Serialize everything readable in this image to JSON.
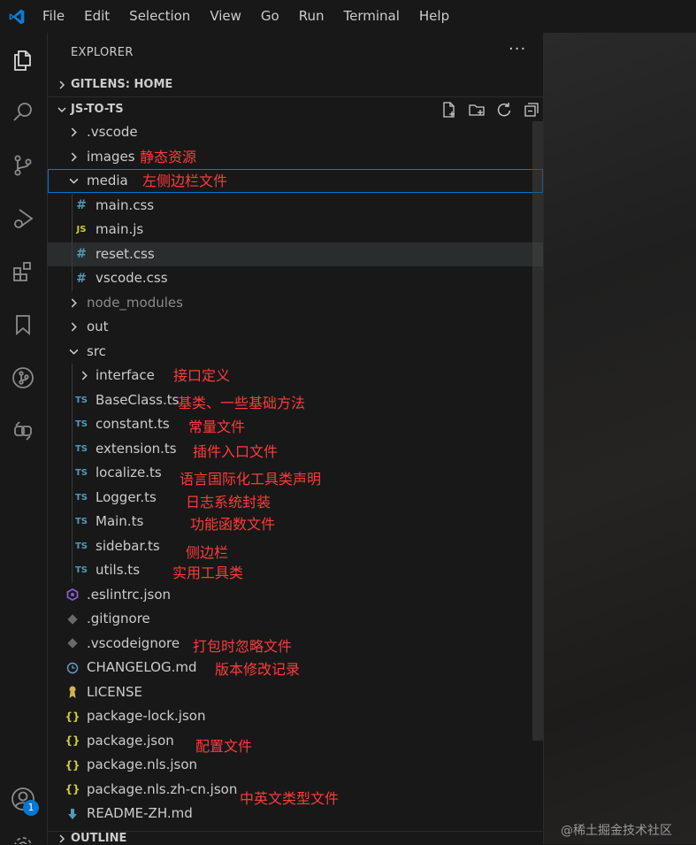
{
  "menu": [
    "File",
    "Edit",
    "Selection",
    "View",
    "Go",
    "Run",
    "Terminal",
    "Help"
  ],
  "activity": {
    "icons": [
      "explorer-icon",
      "search-icon",
      "source-control-icon",
      "run-debug-icon",
      "extensions-icon",
      "bookmarks-icon",
      "gitlens-icon",
      "remote-explorer-icon",
      "accounts-icon",
      "manage-gear-icon"
    ],
    "accounts_badge": "1"
  },
  "sidebar": {
    "title": "EXPLORER",
    "more": "···",
    "sections": {
      "gitlens": "GITLENS: HOME",
      "project": "JS-TO-TS",
      "outline": "OUTLINE"
    },
    "tree": [
      {
        "name": ".vscode",
        "note": "",
        "icon": "folder-chevron"
      },
      {
        "name": "images",
        "note": "静态资源",
        "icon": "folder-chevron"
      },
      {
        "name": "media",
        "note": "左侧边栏文件",
        "icon": "folder-open-chevron"
      },
      {
        "name": "main.css",
        "note": "",
        "icon": "#"
      },
      {
        "name": "main.js",
        "note": "",
        "icon": "JS"
      },
      {
        "name": "reset.css",
        "note": "",
        "icon": "#"
      },
      {
        "name": "vscode.css",
        "note": "",
        "icon": "#"
      },
      {
        "name": "node_modules",
        "note": "",
        "icon": "folder-chevron"
      },
      {
        "name": "out",
        "note": "",
        "icon": "folder-chevron"
      },
      {
        "name": "src",
        "note": "",
        "icon": "folder-open-chevron"
      },
      {
        "name": "interface",
        "note": "接口定义",
        "icon": "folder-chevron"
      },
      {
        "name": "BaseClass.ts",
        "note": "基类、一些基础方法",
        "icon": "TS"
      },
      {
        "name": "constant.ts",
        "note": "常量文件",
        "icon": "TS"
      },
      {
        "name": "extension.ts",
        "note": "插件入口文件",
        "icon": "TS"
      },
      {
        "name": "localize.ts",
        "note": "语言国际化工具类声明",
        "icon": "TS"
      },
      {
        "name": "Logger.ts",
        "note": "日志系统封装",
        "icon": "TS"
      },
      {
        "name": "Main.ts",
        "note": "功能函数文件",
        "icon": "TS"
      },
      {
        "name": "sidebar.ts",
        "note": "侧边栏",
        "icon": "TS"
      },
      {
        "name": "utils.ts",
        "note": "实用工具类",
        "icon": "TS"
      },
      {
        "name": ".eslintrc.json",
        "note": "",
        "icon": "eslint"
      },
      {
        "name": ".gitignore",
        "note": "",
        "icon": "git"
      },
      {
        "name": ".vscodeignore",
        "note": "打包时忽略文件",
        "icon": "git"
      },
      {
        "name": "CHANGELOG.md",
        "note": "版本修改记录",
        "icon": "clock"
      },
      {
        "name": "LICENSE",
        "note": "",
        "icon": "license"
      },
      {
        "name": "package-lock.json",
        "note": "",
        "icon": "{}"
      },
      {
        "name": "package.json",
        "note": "配置文件",
        "icon": "{}"
      },
      {
        "name": "package.nls.json",
        "note": "",
        "icon": "{}"
      },
      {
        "name": "package.nls.zh-cn.json",
        "note": "中英文类型文件",
        "icon": "{}"
      },
      {
        "name": "README-ZH.md",
        "note": "",
        "icon": "readme"
      }
    ]
  },
  "watermark": "@稀土掘金技术社区",
  "colors": {
    "note": "#ff3b3b",
    "ts": "#519aba",
    "css": "#519aba",
    "js": "#cbcb41",
    "json": "#cbcb41",
    "accent": "#0078d4"
  }
}
